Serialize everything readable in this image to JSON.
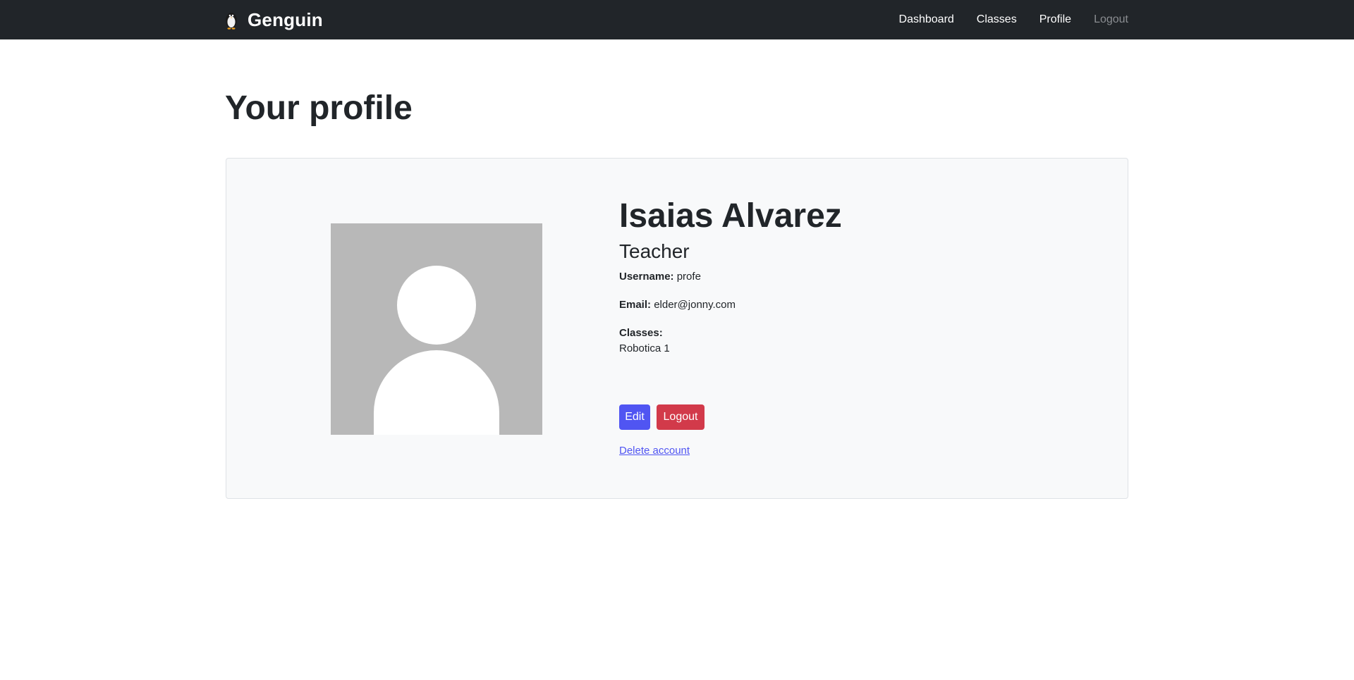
{
  "app": {
    "name": "Genguin",
    "logo_icon": "penguin-icon"
  },
  "nav": {
    "links": [
      {
        "label": "Dashboard",
        "active": true
      },
      {
        "label": "Classes",
        "active": true
      },
      {
        "label": "Profile",
        "active": true
      },
      {
        "label": "Logout",
        "active": false
      }
    ]
  },
  "page": {
    "title": "Your profile"
  },
  "profile": {
    "avatar_icon": "default-avatar-icon",
    "name": "Isaias Alvarez",
    "role": "Teacher",
    "username_label": "Username:",
    "username": "profe",
    "email_label": "Email:",
    "email": "elder@jonny.com",
    "classes_label": "Classes:",
    "classes": [
      "Robotica 1"
    ],
    "edit_label": "Edit",
    "logout_label": "Logout",
    "delete_label": "Delete account"
  },
  "colors": {
    "navbar_bg": "#212529",
    "card_bg": "#f8f9fa",
    "primary": "#5055f2",
    "danger": "#d23a4a",
    "avatar_bg": "#b8b8b8"
  }
}
